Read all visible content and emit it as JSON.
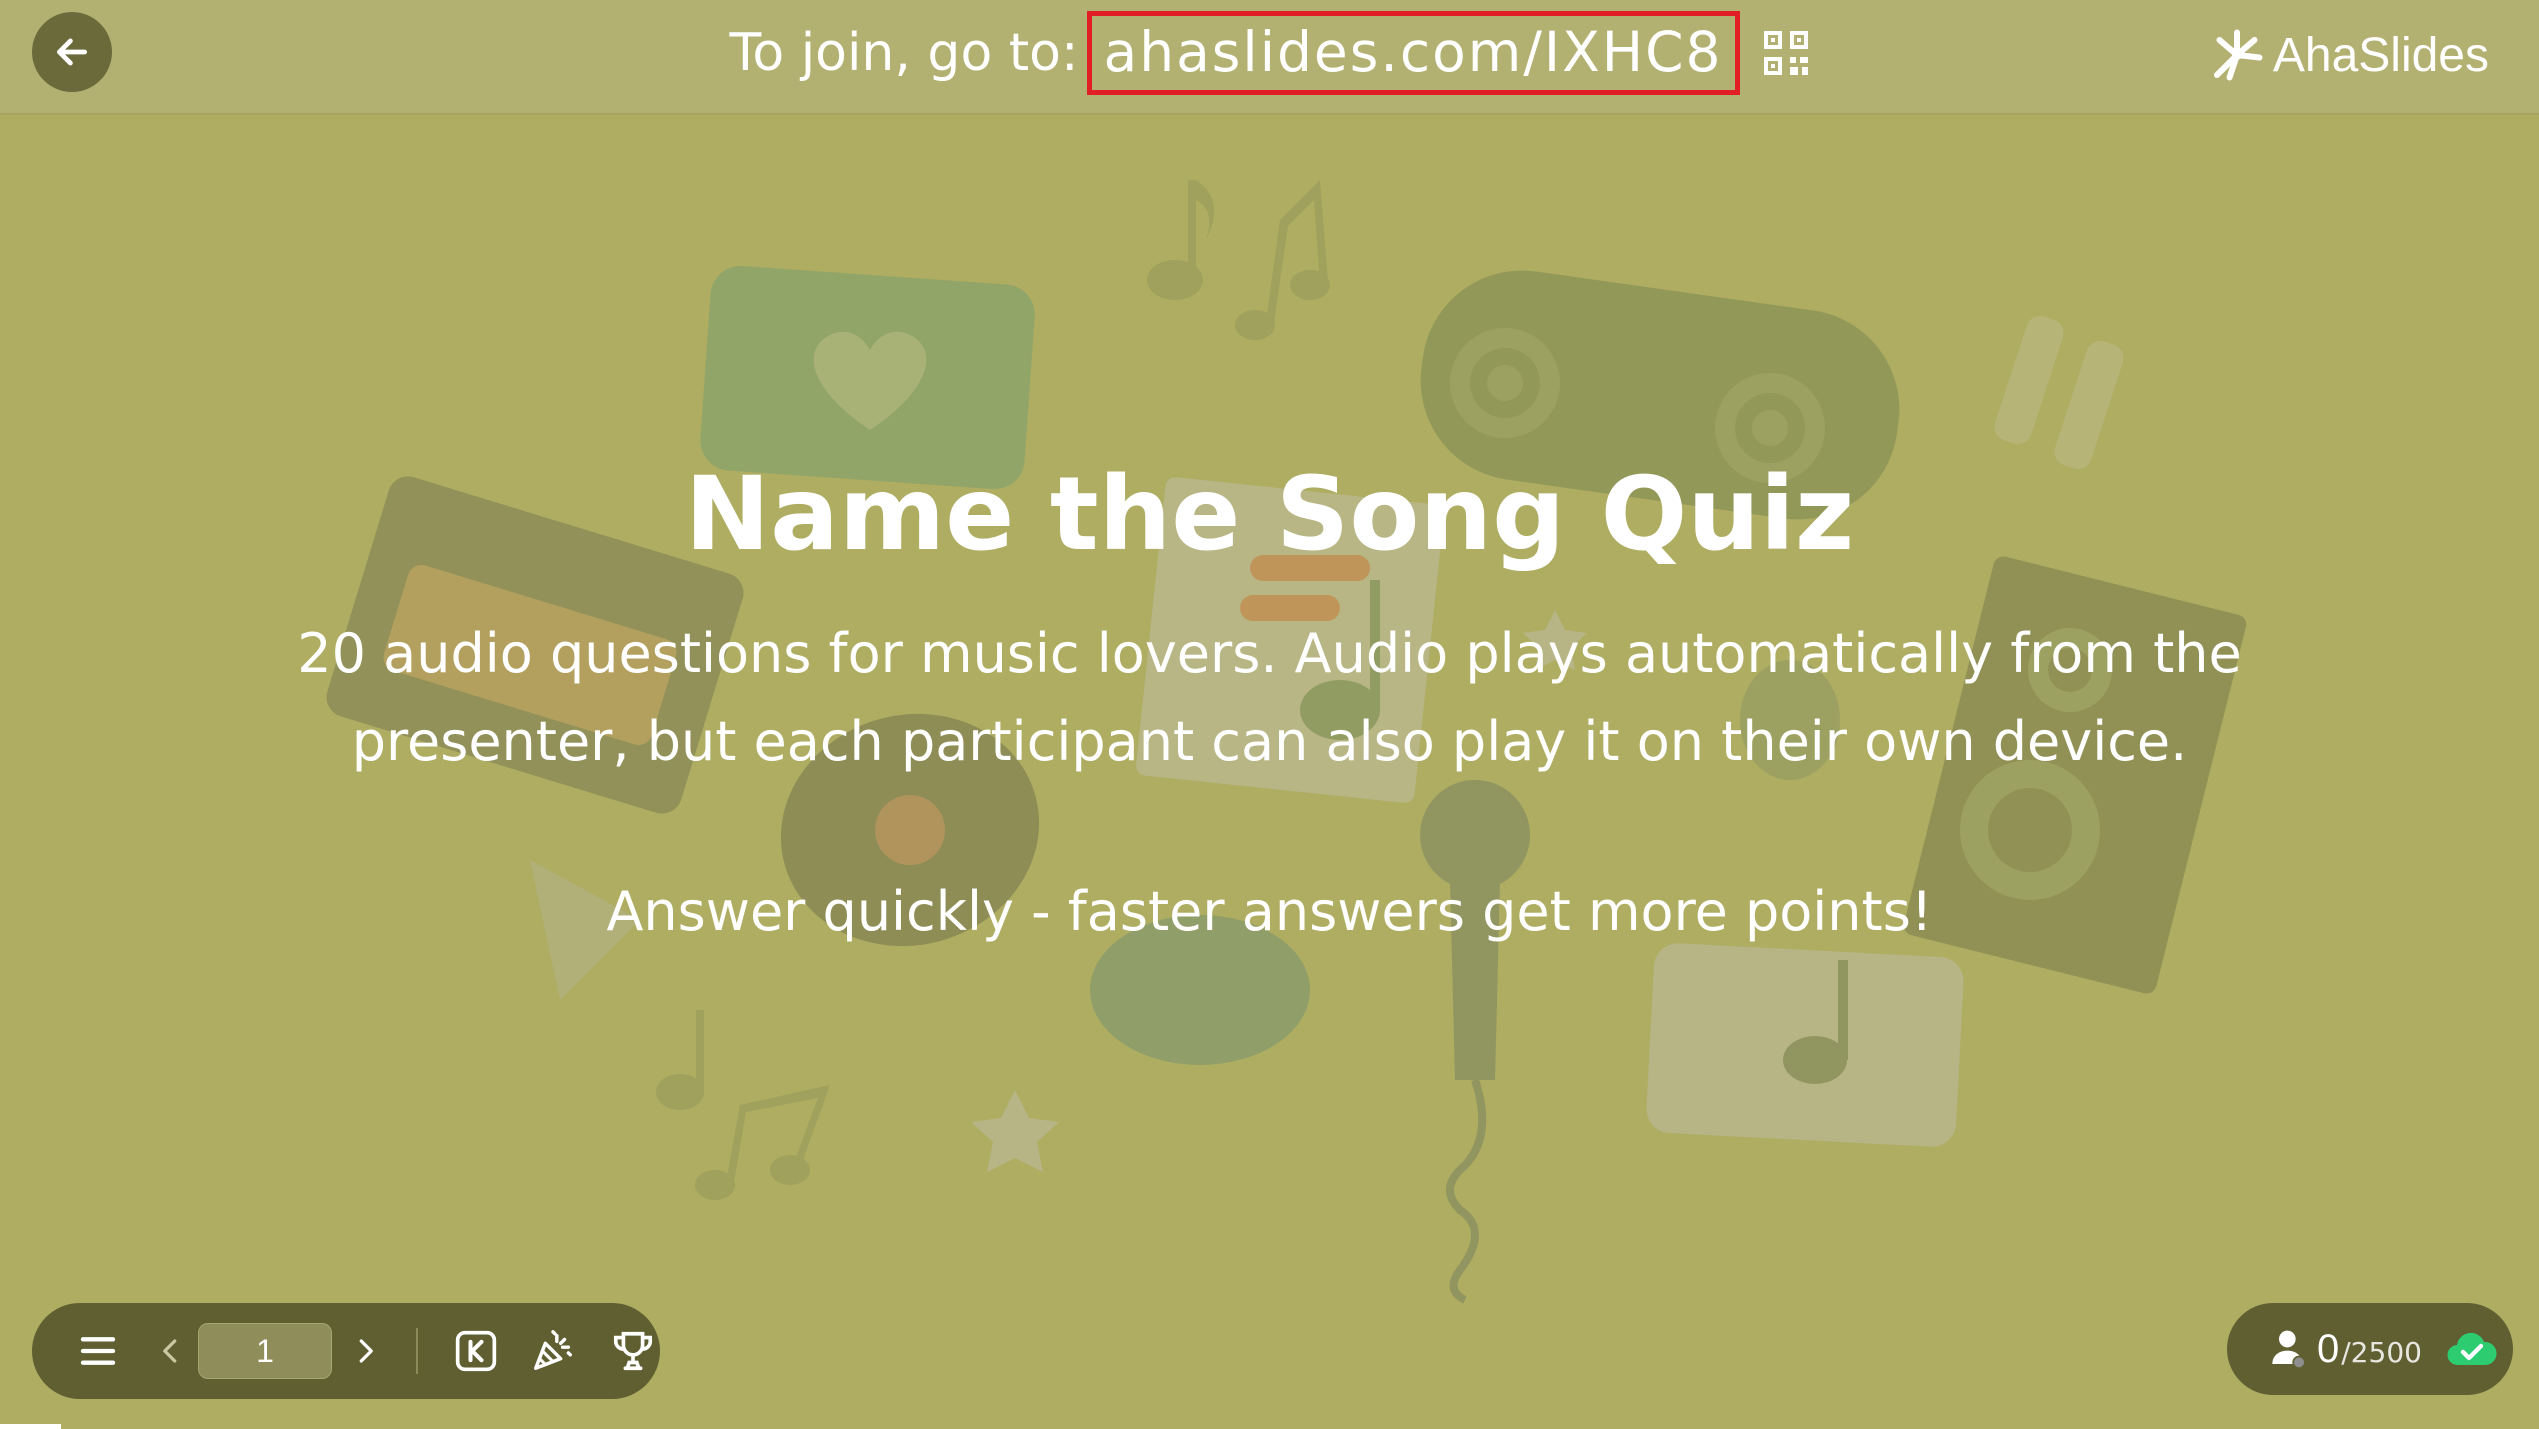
{
  "topbar": {
    "join_label": "To join, go to:",
    "join_url": "ahaslides.com/IXHC8",
    "brand": "AhaSlides",
    "icons": {
      "back": "arrow-left-icon",
      "qr": "qr-code-icon",
      "logo": "ahaslides-logo-icon"
    },
    "highlight_color": "#e11d25"
  },
  "slide": {
    "title": "Name the Song Quiz",
    "description": "20 audio questions for music lovers. Audio plays automatically from the presenter, but each participant can also play it on their own device.",
    "note": "Answer quickly - faster answers get more points!",
    "background_color": "#aead62"
  },
  "toolbar": {
    "page_number": "1",
    "icons": [
      "menu-icon",
      "chevron-left-icon",
      "chevron-right-icon",
      "keyboard-k-icon",
      "party-popper-icon",
      "trophy-icon"
    ]
  },
  "status": {
    "participants": "0",
    "participants_total": "/2500",
    "icons": [
      "participant-icon",
      "cloud-check-icon"
    ]
  },
  "progress": {
    "fraction": 0.024
  }
}
